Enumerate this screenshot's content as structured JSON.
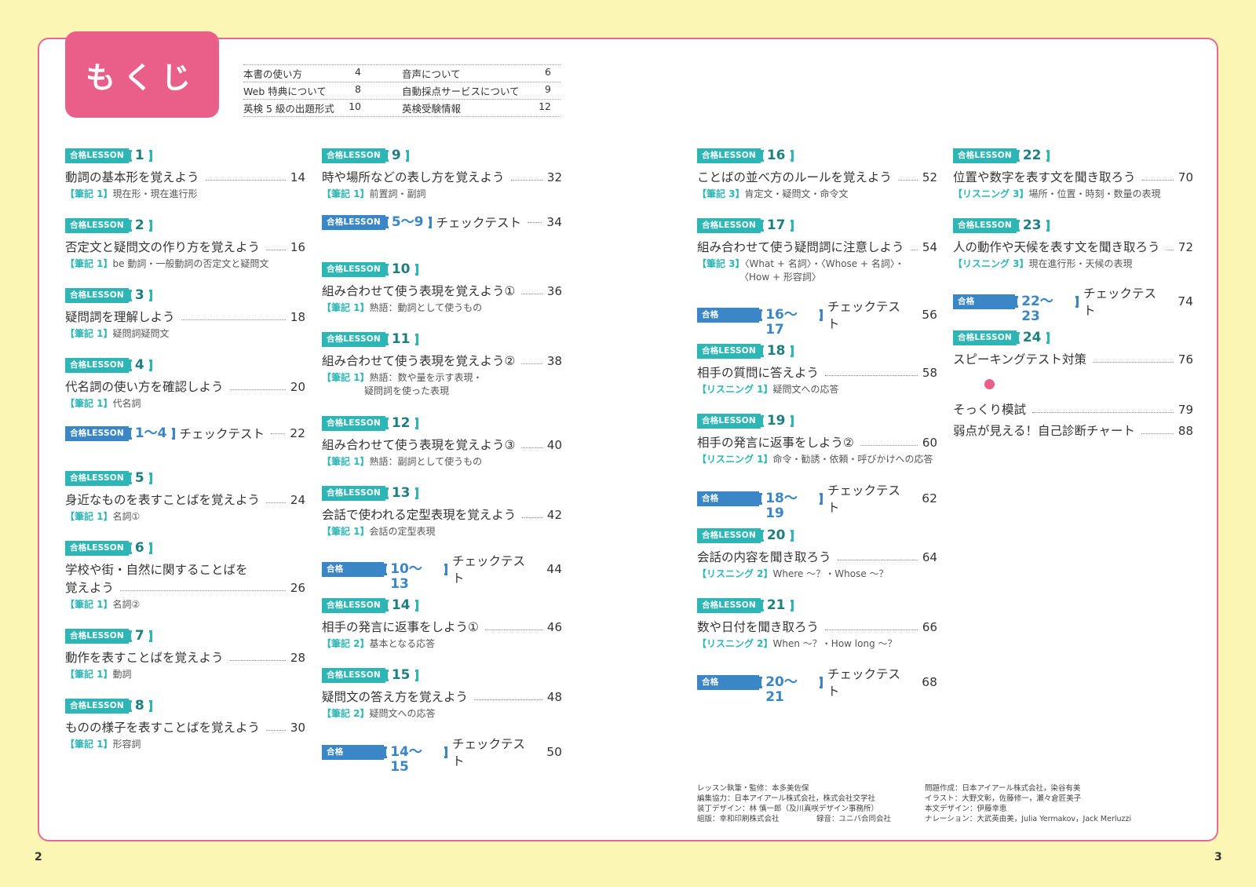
{
  "heading": "もくじ",
  "badge_label": "合格LESSON",
  "check_label": "チェックテスト",
  "front_matter": [
    [
      {
        "label": "本書の使い方",
        "page": "4"
      },
      {
        "label": "音声について",
        "page": "6"
      }
    ],
    [
      {
        "label": "Web 特典について",
        "page": "8"
      },
      {
        "label": "自動採点サービスについて",
        "page": "9"
      }
    ],
    [
      {
        "label": "英検 5 級の出題形式",
        "page": "10"
      },
      {
        "label": "英検受験情報",
        "page": "12"
      }
    ]
  ],
  "lessons": {
    "l1": {
      "num": "1",
      "title": "動詞の基本形を覚えよう",
      "page": "14",
      "tag": "【筆記 1】",
      "sub": "現在形・現在進行形"
    },
    "l2": {
      "num": "2",
      "title": "否定文と疑問文の作り方を覚えよう",
      "page": "16",
      "tag": "【筆記 1】",
      "sub": "be 動詞・一般動詞の否定文と疑問文"
    },
    "l3": {
      "num": "3",
      "title": "疑問詞を理解しよう",
      "page": "18",
      "tag": "【筆記 1】",
      "sub": "疑問詞疑問文"
    },
    "l4": {
      "num": "4",
      "title": "代名詞の使い方を確認しよう",
      "page": "20",
      "tag": "【筆記 1】",
      "sub": "代名詞"
    },
    "c1_4": {
      "num": "1～4",
      "page": "22"
    },
    "l5": {
      "num": "5",
      "title": "身近なものを表すことばを覚えよう",
      "page": "24",
      "tag": "【筆記 1】",
      "sub": "名詞①"
    },
    "l6": {
      "num": "6",
      "pre": "学校や街・自然に関することばを",
      "title": "覚えよう",
      "page": "26",
      "tag": "【筆記 1】",
      "sub": "名詞②"
    },
    "l7": {
      "num": "7",
      "title": "動作を表すことばを覚えよう",
      "page": "28",
      "tag": "【筆記 1】",
      "sub": "動詞"
    },
    "l8": {
      "num": "8",
      "title": "ものの様子を表すことばを覚えよう",
      "page": "30",
      "tag": "【筆記 1】",
      "sub": "形容詞"
    },
    "l9": {
      "num": "9",
      "title": "時や場所などの表し方を覚えよう",
      "page": "32",
      "tag": "【筆記 1】",
      "sub": "前置詞・副詞"
    },
    "c5_9": {
      "num": "5～9",
      "page": "34"
    },
    "l10": {
      "num": "10",
      "title": "組み合わせて使う表現を覚えよう①",
      "page": "36",
      "tag": "【筆記 1】",
      "sub": "熟語：動詞として使うもの"
    },
    "l11": {
      "num": "11",
      "title": "組み合わせて使う表現を覚えよう②",
      "page": "38",
      "tag": "【筆記 1】",
      "sub": "熟語：数や量を示す表現・",
      "sub2": "疑問詞を使った表現"
    },
    "l12": {
      "num": "12",
      "title": "組み合わせて使う表現を覚えよう③",
      "page": "40",
      "tag": "【筆記 1】",
      "sub": "熟語：副詞として使うもの"
    },
    "l13": {
      "num": "13",
      "title": "会話で使われる定型表現を覚えよう",
      "page": "42",
      "tag": "【筆記 1】",
      "sub": "会話の定型表現"
    },
    "c10_13": {
      "num": "10～13",
      "page": "44"
    },
    "l14": {
      "num": "14",
      "title": "相手の発言に返事をしよう①",
      "page": "46",
      "tag": "【筆記 2】",
      "sub": "基本となる応答"
    },
    "l15": {
      "num": "15",
      "title": "疑問文の答え方を覚えよう",
      "page": "48",
      "tag": "【筆記 2】",
      "sub": "疑問文への応答"
    },
    "c14_15": {
      "num": "14～15",
      "page": "50"
    },
    "l16": {
      "num": "16",
      "title": "ことばの並べ方のルールを覚えよう",
      "page": "52",
      "tag": "【筆記 3】",
      "sub": "肯定文・疑問文・命令文"
    },
    "l17": {
      "num": "17",
      "title": "組み合わせて使う疑問詞に注意しよう",
      "page": "54",
      "tag": "【筆記 3】",
      "sub": "〈What + 名詞〉・〈Whose + 名詞〉・",
      "sub2": "〈How + 形容詞〉"
    },
    "c16_17": {
      "num": "16～17",
      "page": "56"
    },
    "l18": {
      "num": "18",
      "title": "相手の質問に答えよう",
      "page": "58",
      "tag": "【リスニング 1】",
      "sub": "疑問文への応答"
    },
    "l19": {
      "num": "19",
      "title": "相手の発言に返事をしよう②",
      "page": "60",
      "tag": "【リスニング 1】",
      "sub": "命令・勧誘・依頼・呼びかけへの応答"
    },
    "c18_19": {
      "num": "18～19",
      "page": "62"
    },
    "l20": {
      "num": "20",
      "title": "会話の内容を聞き取ろう",
      "page": "64",
      "tag": "【リスニング 2】",
      "sub": "Where ～？・Whose ～？"
    },
    "l21": {
      "num": "21",
      "title": "数や日付を聞き取ろう",
      "page": "66",
      "tag": "【リスニング 2】",
      "sub": "When ～？・How long ～？"
    },
    "c20_21": {
      "num": "20～21",
      "page": "68"
    },
    "l22": {
      "num": "22",
      "title": "位置や数字を表す文を聞き取ろう",
      "page": "70",
      "tag": "【リスニング 3】",
      "sub": "場所・位置・時刻・数量の表現"
    },
    "l23": {
      "num": "23",
      "title": "人の動作や天候を表す文を聞き取ろう",
      "page": "72",
      "tag": "【リスニング 3】",
      "sub": "現在進行形・天候の表現"
    },
    "c22_23": {
      "num": "22～23",
      "page": "74"
    },
    "l24": {
      "num": "24",
      "title": "スピーキングテスト対策",
      "page": "76"
    }
  },
  "extras": [
    {
      "title": "そっくり模試",
      "page": "79"
    },
    {
      "title": "弱点が見える！自己診断チャート",
      "page": "88"
    }
  ],
  "credits_left": [
    "レッスン執筆・監修：本多美佐保",
    "編集協力：日本アイアール株式会社，株式会社交学社",
    "装丁デザイン：林 慎一郎（及川真咲デザイン事務所）",
    "組版：幸和印刷株式会社　　　　　録音：ユニバ合同会社"
  ],
  "credits_right": [
    "問題作成：日本アイアール株式会社，染谷有美",
    "イラスト：大野文彰，佐藤修一，瀬々倉匠美子",
    "本文デザイン：伊藤幸恵",
    "ナレーション：大武英由美，Julia Yermakov，Jack Merluzzi"
  ],
  "page_left": "2",
  "page_right": "3"
}
